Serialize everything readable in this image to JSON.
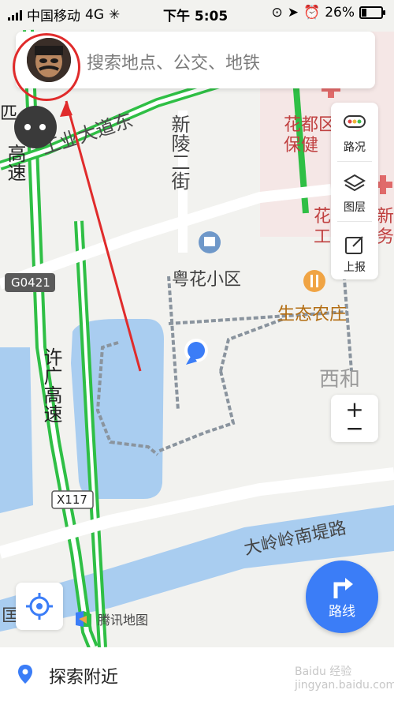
{
  "status_bar": {
    "carrier": "中国移动",
    "network": "4G",
    "time": "下午 5:05",
    "battery": "26%",
    "battery_level": 0.26
  },
  "search": {
    "placeholder": "搜索地点、公交、地铁"
  },
  "side_panel": {
    "items": [
      {
        "label": "路况",
        "icon": "traffic-light-icon"
      },
      {
        "label": "图层",
        "icon": "layers-icon"
      },
      {
        "label": "上报",
        "icon": "report-edit-icon"
      }
    ]
  },
  "zoom": {
    "plus": "+",
    "minus": "−"
  },
  "route": {
    "label": "路线"
  },
  "brand": {
    "label": "腾讯地图"
  },
  "bottom": {
    "label": "探索附近"
  },
  "map_labels": {
    "road_east": "工业大道东",
    "xinling": "新陵二街",
    "gaosu_left": "高速",
    "g0421": "G0421",
    "yuehua": "粤花小区",
    "shengtai": "生态农庄",
    "xihe": "西和",
    "xuguang": "许广高速",
    "x117": "X117",
    "dalingling": "大岭岭南堤路",
    "huadu_top": "花都区",
    "baojian": "保健",
    "hua_right": "花",
    "xin_right": "新",
    "gong": "工",
    "wu": "务",
    "left_edge_top": "匹",
    "left_edge_bottom": "匡"
  },
  "watermark": "Baidu 经验 jingyan.baidu.com",
  "colors": {
    "accent": "#3b7df7",
    "highway": "#2fbf45",
    "highlight_red": "#e02b2b",
    "water": "#a9cdf0"
  }
}
